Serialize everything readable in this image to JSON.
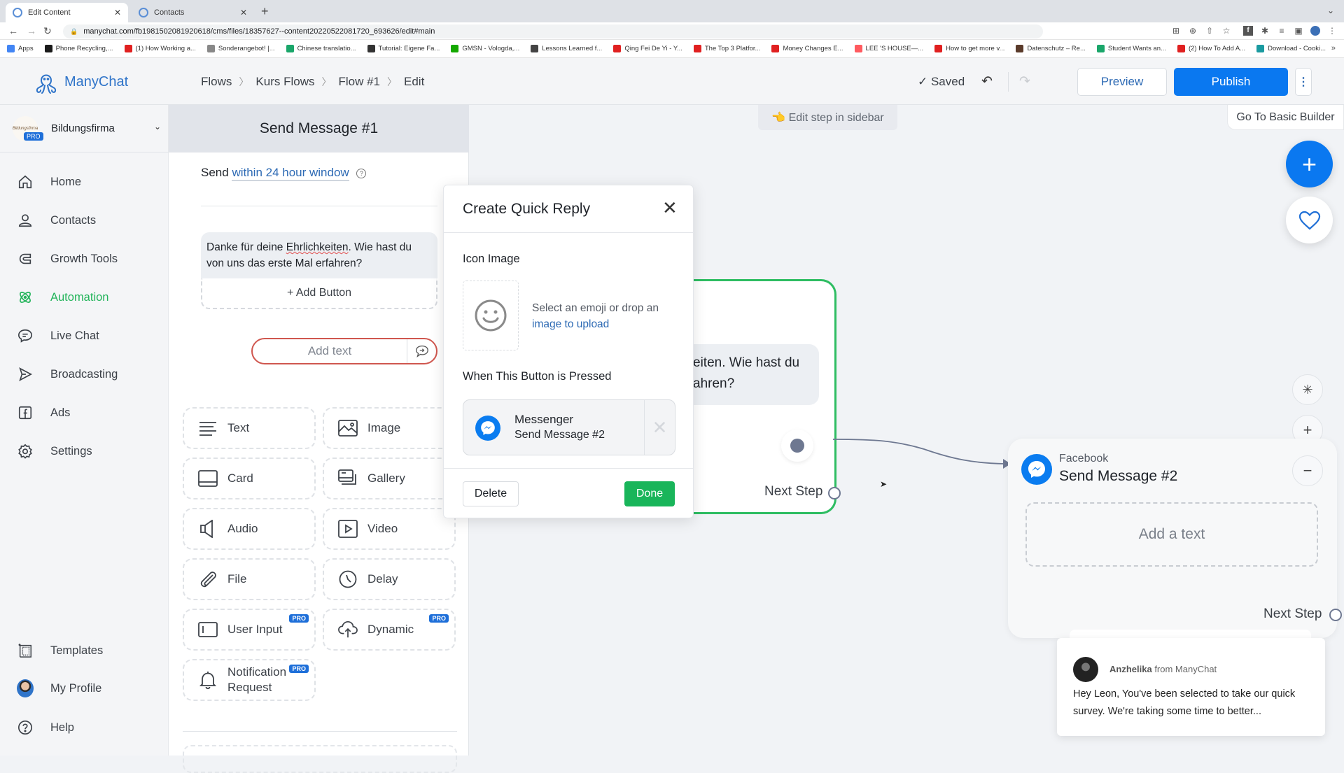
{
  "browser": {
    "tabs": [
      {
        "label": "Edit Content",
        "active": true
      },
      {
        "label": "Contacts",
        "active": false
      }
    ],
    "url": "manychat.com/fb198150208192061​8/cms/files/18357627--content20220522081720_693626/edit#main",
    "bookmarks": [
      {
        "label": "Apps",
        "color": "#4285f4"
      },
      {
        "label": "Phone Recycling,...",
        "color": "#1a1a1a"
      },
      {
        "label": "(1) How Working a...",
        "color": "#e02020"
      },
      {
        "label": "Sonderangebot! |...",
        "color": "#888888"
      },
      {
        "label": "Chinese translatio...",
        "color": "#1aa66a"
      },
      {
        "label": "Tutorial: Eigene Fa...",
        "color": "#333333"
      },
      {
        "label": "GMSN - Vologda,...",
        "color": "#14a800"
      },
      {
        "label": "Lessons Learned f...",
        "color": "#444444"
      },
      {
        "label": "Qing Fei De Yi - Y...",
        "color": "#e02020"
      },
      {
        "label": "The Top 3 Platfor...",
        "color": "#e02020"
      },
      {
        "label": "Money Changes E...",
        "color": "#e02020"
      },
      {
        "label": "LEE 'S HOUSE—...",
        "color": "#ff5a5f"
      },
      {
        "label": "How to get more v...",
        "color": "#e02020"
      },
      {
        "label": "Datenschutz – Re...",
        "color": "#5a3a2a"
      },
      {
        "label": "Student Wants an...",
        "color": "#1aa66a"
      },
      {
        "label": "(2) How To Add A...",
        "color": "#e02020"
      },
      {
        "label": "Download - Cooki...",
        "color": "#1a9aa0"
      }
    ],
    "bookmarks_more": "»"
  },
  "header": {
    "logo": "ManyChat",
    "breadcrumb": [
      "Flows",
      "Kurs Flows",
      "Flow #1",
      "Edit"
    ],
    "saved": "✓ Saved",
    "preview": "Preview",
    "publish": "Publish",
    "more": "⋮"
  },
  "sidebar": {
    "account": {
      "name": "Bildungsfirma",
      "badge": "PRO",
      "avatar_text": "Bildungsfirma"
    },
    "items": [
      {
        "label": "Home",
        "icon": "home-icon",
        "active": false
      },
      {
        "label": "Contacts",
        "icon": "user-icon",
        "active": false
      },
      {
        "label": "Growth Tools",
        "icon": "magnet-icon",
        "active": false
      },
      {
        "label": "Automation",
        "icon": "automation-icon",
        "active": true
      },
      {
        "label": "Live Chat",
        "icon": "chat-icon",
        "active": false
      },
      {
        "label": "Broadcasting",
        "icon": "send-icon",
        "active": false
      },
      {
        "label": "Ads",
        "icon": "facebook-icon",
        "active": false
      },
      {
        "label": "Settings",
        "icon": "gear-icon",
        "active": false
      }
    ],
    "bottom_items": [
      {
        "label": "Templates",
        "icon": "templates-icon"
      },
      {
        "label": "My Profile",
        "icon": "avatar"
      },
      {
        "label": "Help",
        "icon": "help-icon"
      }
    ]
  },
  "editor": {
    "title": "Send Message #1",
    "send_prefix": "Send",
    "send_window": "within 24 hour window",
    "message_part1": "Danke für deine ",
    "message_misspelled": "Ehrlichkeiten",
    "message_part2": ". Wie hast du von uns das erste Mal erfahren?",
    "add_button": "+ Add Button",
    "add_text": "Add text",
    "blocks": [
      {
        "label": "Text",
        "icon": "text-icon",
        "pro": false
      },
      {
        "label": "Image",
        "icon": "image-icon",
        "pro": false
      },
      {
        "label": "Card",
        "icon": "card-icon",
        "pro": false
      },
      {
        "label": "Gallery",
        "icon": "gallery-icon",
        "pro": false
      },
      {
        "label": "Audio",
        "icon": "audio-icon",
        "pro": false
      },
      {
        "label": "Video",
        "icon": "video-icon",
        "pro": false
      },
      {
        "label": "File",
        "icon": "paperclip-icon",
        "pro": false
      },
      {
        "label": "Delay",
        "icon": "clock-icon",
        "pro": false
      },
      {
        "label": "User Input",
        "icon": "input-icon",
        "pro": true
      },
      {
        "label": "Dynamic",
        "icon": "cloud-upload-icon",
        "pro": true
      },
      {
        "label": "Notification Request",
        "icon": "bell-icon",
        "pro": true
      }
    ],
    "pro_badge": "PRO"
  },
  "canvas": {
    "edit_step_tip": "👈 Edit step in sidebar",
    "basic_builder": "Go To Basic Builder",
    "node1": {
      "message_visible": "eiten. Wie hast du\nahren?",
      "next_step": "Next Step"
    },
    "node2": {
      "channel": "Facebook",
      "title": "Send Message #2",
      "add_text": "Add a text",
      "next_step": "Next Step"
    }
  },
  "modal": {
    "title": "Create Quick Reply",
    "icon_label": "Icon Image",
    "icon_hint": "Select an emoji or drop an",
    "icon_link": "image to upload",
    "pressed_label": "When This Button is Pressed",
    "action_channel": "Messenger",
    "action_target": "Send Message #2",
    "delete": "Delete",
    "done": "Done"
  },
  "chat_popup": {
    "sender": "Anzhelika",
    "from": "from ManyChat",
    "message": "Hey Leon,  You've been selected to take our quick survey. We're taking some time to better..."
  },
  "colors": {
    "accent_blue": "#0a78f0",
    "active_green": "#22b45a",
    "done_green": "#19b55a",
    "node_border": "#2ebd62",
    "pro_badge": "#1e6fd9"
  }
}
